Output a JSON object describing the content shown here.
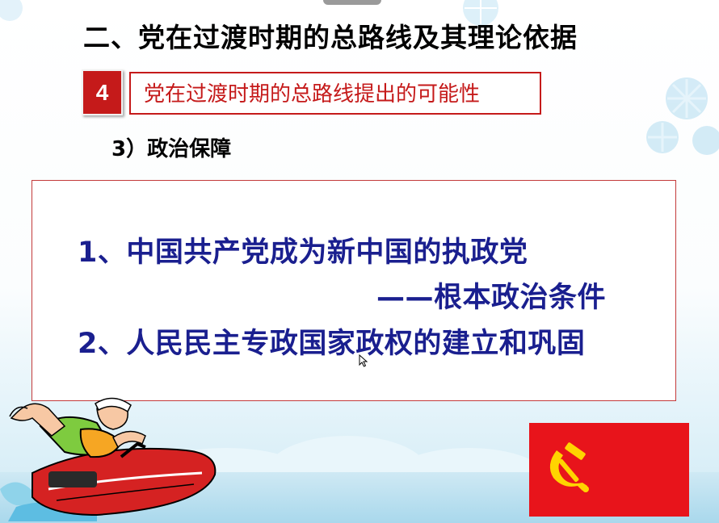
{
  "slide": {
    "title": "二、党在过渡时期的总路线及其理论依据",
    "badge_number": "4",
    "subtitle": "党在过渡时期的总路线提出的可能性",
    "section": "3）政治保障",
    "items": [
      {
        "line1": "1、中国共产党成为新中国的执政党",
        "line2": "——根本政治条件"
      },
      {
        "line1": "2、人民民主专政国家政权的建立和巩固"
      }
    ]
  },
  "colors": {
    "accent_red": "#c51a1a",
    "content_blue": "#1a1f8f",
    "flag_red": "#e8141b",
    "flag_gold": "#ffd400"
  },
  "icons": [
    "hammer-sickle-icon",
    "mouse-pointer-icon",
    "snowflake-icon"
  ]
}
